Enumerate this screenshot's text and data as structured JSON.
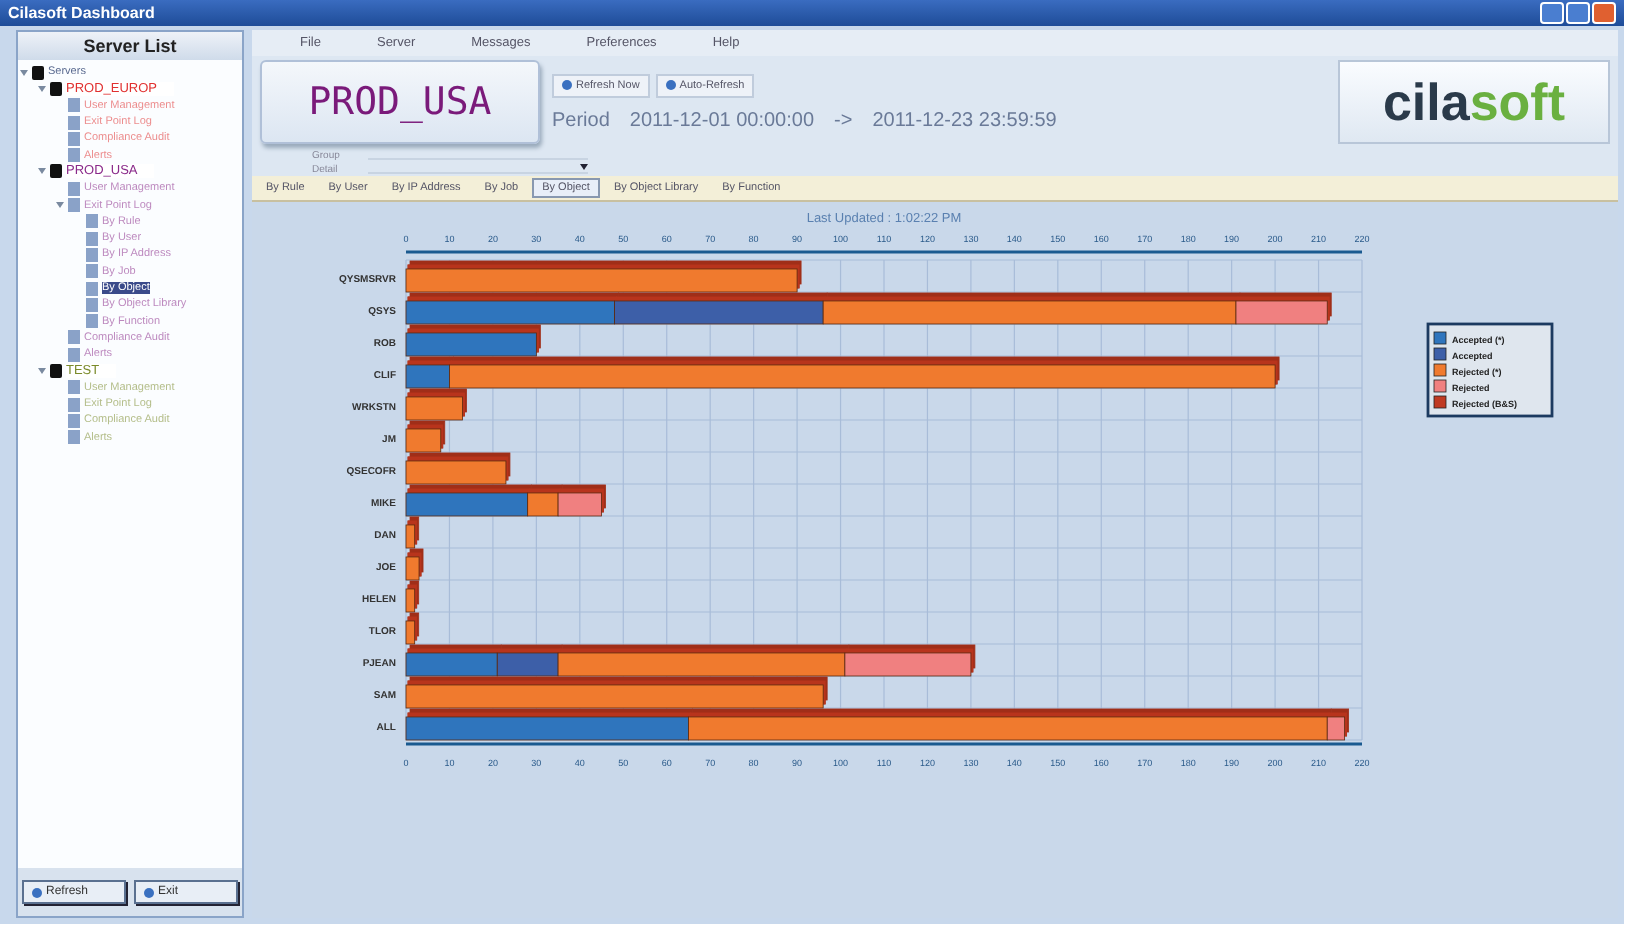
{
  "window": {
    "title": "Cilasoft Dashboard"
  },
  "sidebar": {
    "title": "Server List",
    "tree": [
      {
        "label": "Servers",
        "selected": false,
        "expanded": true,
        "children": [
          {
            "label": "PROD_EUROP",
            "color": "#e03030",
            "selected": false,
            "expanded": true,
            "children": [
              {
                "label": "User Management",
                "selected": false
              },
              {
                "label": "Exit Point Log",
                "selected": false
              },
              {
                "label": "Compliance Audit",
                "selected": false
              },
              {
                "label": "Alerts",
                "selected": false
              }
            ]
          },
          {
            "label": "PROD_USA",
            "color": "#8a2a8a",
            "selected": false,
            "expanded": true,
            "children": [
              {
                "label": "User Management",
                "selected": false
              },
              {
                "label": "Exit Point Log",
                "selected": false,
                "expanded": true,
                "children": [
                  {
                    "label": "By Rule",
                    "selected": false
                  },
                  {
                    "label": "By User",
                    "selected": false
                  },
                  {
                    "label": "By IP Address",
                    "selected": false
                  },
                  {
                    "label": "By Job",
                    "selected": false
                  },
                  {
                    "label": "By Object",
                    "selected": true
                  },
                  {
                    "label": "By Object Library",
                    "selected": false
                  },
                  {
                    "label": "By Function",
                    "selected": false
                  }
                ]
              },
              {
                "label": "Compliance Audit",
                "selected": false
              },
              {
                "label": "Alerts",
                "selected": false
              }
            ]
          },
          {
            "label": "TEST",
            "color": "#7a8a2a",
            "selected": false,
            "expanded": true,
            "children": [
              {
                "label": "User Management",
                "selected": false
              },
              {
                "label": "Exit Point Log",
                "selected": false
              },
              {
                "label": "Compliance Audit",
                "selected": false
              },
              {
                "label": "Alerts",
                "selected": false
              }
            ]
          }
        ]
      }
    ],
    "buttons": [
      "Refresh",
      "Exit"
    ]
  },
  "menu": [
    "File",
    "Server",
    "Messages",
    "Preferences",
    "Help"
  ],
  "server_name": "PROD_USA",
  "toolbar": [
    "Refresh Now",
    "Auto-Refresh"
  ],
  "period": {
    "label": "Period",
    "from": "2011-12-01  00:00:00",
    "arrow": "->",
    "to": "2011-12-23  23:59:59"
  },
  "filters": [
    "Group",
    "Detail"
  ],
  "logo": {
    "first": "cila",
    "second": "soft"
  },
  "tabs": [
    {
      "label": "By Rule",
      "selected": false
    },
    {
      "label": "By User",
      "selected": false
    },
    {
      "label": "By IP Address",
      "selected": false
    },
    {
      "label": "By Job",
      "selected": false
    },
    {
      "label": "By Object",
      "selected": true
    },
    {
      "label": "By Object Library",
      "selected": false
    },
    {
      "label": "By Function",
      "selected": false
    }
  ],
  "chart": {
    "top_axis_labels": [
      "0",
      "10",
      "20",
      "30",
      "40",
      "50",
      "60",
      "70",
      "80",
      "90",
      "100",
      "110",
      "120",
      "130",
      "140",
      "150",
      "160",
      "170",
      "180",
      "190",
      "200",
      "210",
      "220"
    ],
    "chart_data": {
      "type": "bar",
      "orientation": "horizontal",
      "stacked": true,
      "title": "Last Updated : 1:02:22 PM",
      "categories": [
        "QYSMSRVR",
        "QSYS",
        "ROB",
        "CLIF",
        "WRKSTN",
        "JM",
        "QSECOFR",
        "MIKE",
        "DAN",
        "JOE",
        "HELEN",
        "TLOR",
        "PJEAN",
        "SAM",
        "ALL"
      ],
      "series": [
        {
          "name": "Accepted (*)",
          "color": "#2f75bd",
          "values": [
            0,
            48,
            30,
            10,
            0,
            0,
            0,
            28,
            0,
            0,
            0,
            0,
            21,
            0,
            65
          ]
        },
        {
          "name": "Accepted",
          "color": "#3d5fa8",
          "values": [
            0,
            48,
            0,
            0,
            0,
            0,
            0,
            0,
            0,
            0,
            0,
            0,
            14,
            0,
            0
          ]
        },
        {
          "name": "Rejected (*)",
          "color": "#f07a2e",
          "values": [
            90,
            95,
            0,
            190,
            13,
            8,
            23,
            7,
            2,
            3,
            2,
            2,
            66,
            96,
            147
          ]
        },
        {
          "name": "Rejected",
          "color": "#f08080",
          "values": [
            0,
            21,
            0,
            0,
            0,
            0,
            0,
            10,
            0,
            0,
            0,
            0,
            29,
            0,
            4
          ]
        },
        {
          "name": "Rejected (B&S)",
          "color": "#c03a22",
          "values": [
            0,
            0,
            0,
            0,
            0,
            0,
            0,
            0,
            0,
            0,
            0,
            0,
            0,
            0,
            0
          ]
        }
      ],
      "grid": true,
      "legend": true,
      "xlim": [
        0,
        220
      ],
      "xticks": [
        0,
        10,
        20,
        30,
        40,
        50,
        60,
        70,
        80,
        90,
        100,
        110,
        120,
        130,
        140,
        150,
        160,
        170,
        180,
        190,
        200,
        210,
        220
      ]
    }
  }
}
